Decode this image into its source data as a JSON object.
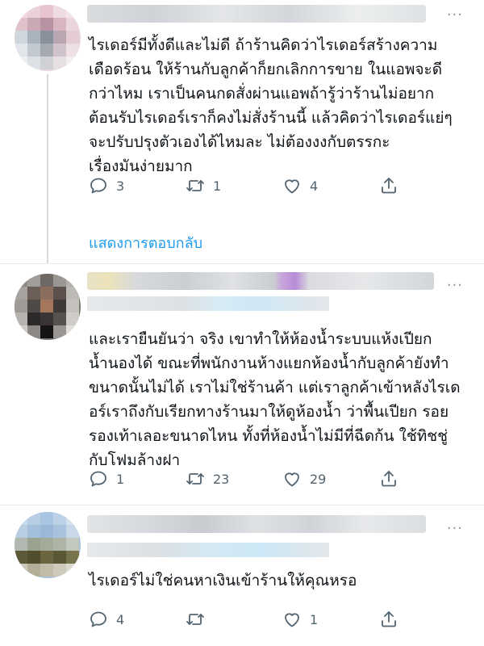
{
  "tweets": [
    {
      "text_lines": [
        "ไรเดอร์มีทั้งดีและไม่ดี  ถ้าร้านคิดว่าไรเดอร์สร้างความ",
        "เดือดร้อน ให้ร้านกับลูกค้าก็ยกเลิกการขาย ในแอพจะดี",
        "กว่าไหม   เราเป็นคนกดสั่งผ่านแอพถ้ารู้ว่าร้านไม่อยาก",
        "ต้อนรับไรเดอร์เราก็คงไม่สั่งร้านนี้ แล้วคิดว่าไรเดอร์แย่ๆ",
        "จะปรับปรุงตัวเองได้ไหมละ ไม่ต้องงงกับตรรกะ",
        "เรื่องมันง่ายมาก"
      ],
      "replies": "3",
      "retweets": "1",
      "likes": "4",
      "show_replies": "แสดงการตอบกลับ"
    },
    {
      "text_lines": [
        "และเรายืนยันว่า จริง เขาทำให้ห้องน้ำระบบแห้งเปียก",
        "น้ำนองได้ ขณะที่พนักงานห้างแยกห้องน้ำกับลูกค้ายังทำ",
        "ขนาดนั้นไม่ได้ เราไม่ใช่ร้านค้า แต่เราลูกค้าเข้าหลังไรเด",
        "อร์เราถึงกับเรียกทางร้านมาให้ดูห้องน้ำ ว่าพื้นเปียก รอย",
        "รองเท้าเลอะขนาดไหน ทั้งที่ห้องน้ำไม่มีที่ฉีดก้น ใช้ทิชชู่",
        "กับโฟมล้างฝา"
      ],
      "replies": "1",
      "retweets": "23",
      "likes": "29"
    },
    {
      "text_lines": [
        "ไรเดอร์ไม่ใช่คนหาเงินเข้าร้านให้คุณหรอ"
      ],
      "replies": "4",
      "retweets": "",
      "likes": "1"
    }
  ],
  "icons": {
    "reply": "reply-icon",
    "retweet": "retweet-icon",
    "like": "heart-icon",
    "share": "share-icon",
    "more": "more-icon"
  },
  "colors": {
    "link": "#1d9bf0",
    "action": "#536471",
    "divider": "#e6ecf0"
  }
}
